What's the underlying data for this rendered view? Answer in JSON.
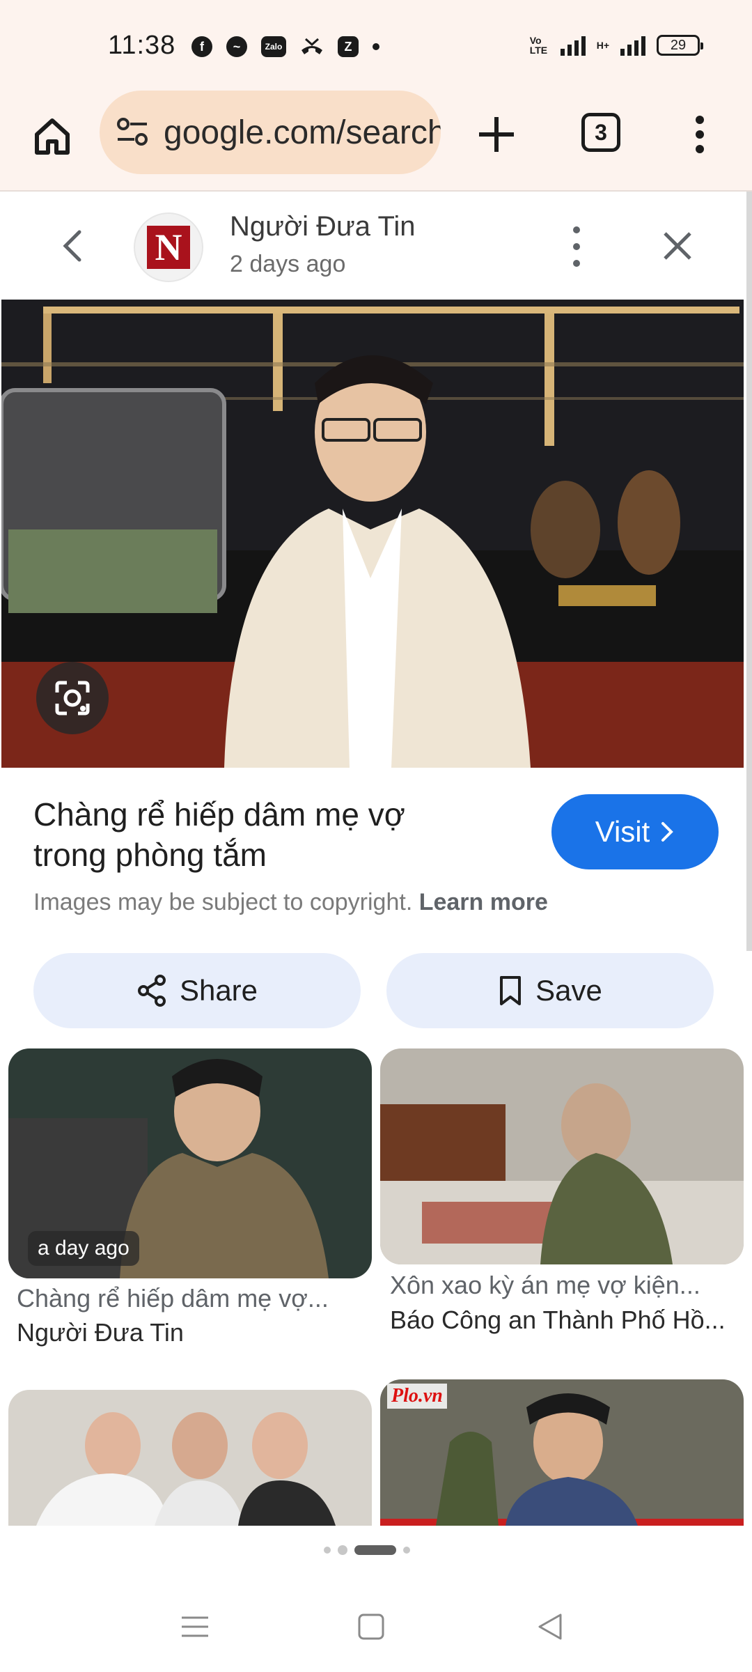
{
  "status_bar": {
    "time": "11:38",
    "app_icons": [
      "facebook-icon",
      "messenger-icon",
      "zalo-icon",
      "missed-call-icon",
      "z-app-icon",
      "dot-icon"
    ],
    "zalo_label": "Zalo",
    "volte_label": "Vo LTE",
    "network_label": "H+",
    "battery": "29"
  },
  "browser": {
    "url": "google.com/search",
    "tab_count": "3"
  },
  "publisher": {
    "name": "Người Đưa Tin",
    "logo_letter": "N",
    "time": "2 days ago"
  },
  "result": {
    "title": "Chàng rể hiếp dâm mẹ vợ trong phòng tắm",
    "copyright": "Images may be subject to copyright.",
    "learn_more": "Learn more",
    "visit_label": "Visit"
  },
  "actions": {
    "share_label": "Share",
    "save_label": "Save"
  },
  "related": [
    {
      "time": "a day ago",
      "title": "Chàng rể hiếp dâm mẹ vợ...",
      "source": "Người Đưa Tin"
    },
    {
      "title": "Xôn xao kỳ án mẹ vợ kiện...",
      "source": "Báo Công an Thành Phố Hồ..."
    },
    {
      "watermark": "Plo.vn"
    }
  ],
  "pager": {
    "page_count": 4,
    "active_index": 2
  },
  "colors": {
    "chrome_bg": "#fdf3ee",
    "urlbar_bg": "#f9dfc9",
    "accent_blue": "#1a73e8",
    "pill_bg": "#e8eefb",
    "publisher_red": "#a9121c"
  }
}
